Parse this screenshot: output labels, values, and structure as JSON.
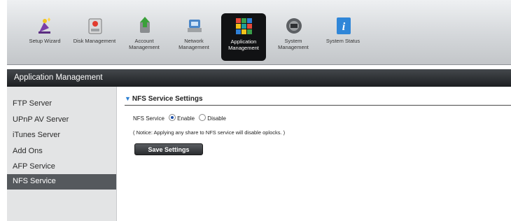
{
  "nav": [
    {
      "label": "Setup Wizard",
      "icon": "wizard-icon"
    },
    {
      "label": "Disk Management",
      "icon": "disk-icon"
    },
    {
      "label": "Account Management",
      "icon": "account-icon"
    },
    {
      "label": "Network Management",
      "icon": "network-icon"
    },
    {
      "label": "Application Management",
      "icon": "application-icon",
      "active": true
    },
    {
      "label": "System Management",
      "icon": "system-icon"
    },
    {
      "label": "System Status",
      "icon": "info-icon"
    }
  ],
  "section": {
    "title": "Application Management"
  },
  "sidebar": {
    "items": [
      {
        "label": "FTP Server"
      },
      {
        "label": "UPnP AV Server"
      },
      {
        "label": "iTunes Server"
      },
      {
        "label": "Add Ons"
      },
      {
        "label": "AFP Service"
      },
      {
        "label": "NFS Service",
        "active": true
      }
    ]
  },
  "nfs": {
    "header": "NFS Service Settings",
    "service_label": "NFS Service",
    "enable_label": "Enable",
    "disable_label": "Disable",
    "selected": "Enable",
    "notice": "( Notice: Applying any share to NFS service will disable oplocks. )",
    "save_label": "Save Settings"
  },
  "colors": {
    "accent": "#2b7fd3",
    "active_nav": "#111214",
    "sidebar_active": "#55595d"
  }
}
